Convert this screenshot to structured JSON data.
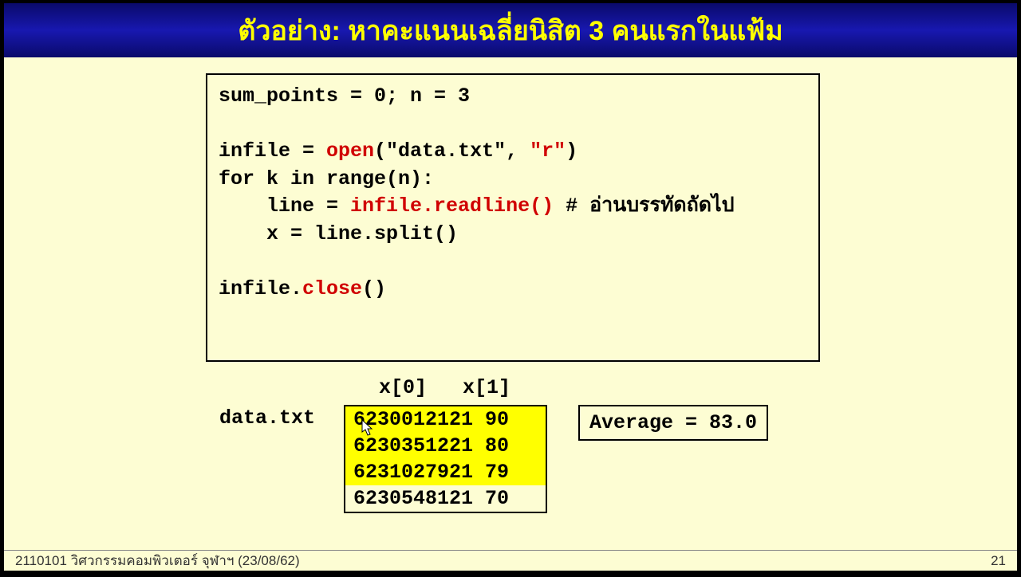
{
  "title": "ตัวอย่าง: หาคะแนนเฉลี่ยนิสิต 3 คนแรกในแฟ้ม",
  "code": {
    "l1": "sum_points = 0; n = 3",
    "l2_a": "infile = ",
    "l2_open": "open",
    "l2_b": "(\"data.txt\", ",
    "l2_r": "\"r\"",
    "l2_c": ")",
    "l3": "for k in range(n):",
    "l4_a": "    line = ",
    "l4_read": "infile.readline()",
    "l4_b": " # อ่านบรรทัดถัดไป",
    "l5": "    x = line.split()",
    "l6_a": "infile.",
    "l6_close": "close",
    "l6_b": "()"
  },
  "data_label": "data.txt",
  "index_labels": "x[0]   x[1]",
  "file_rows": [
    {
      "text": "6230012121 90",
      "highlight": true
    },
    {
      "text": "6230351221 80",
      "highlight": true
    },
    {
      "text": "6231027921 79",
      "highlight": true
    },
    {
      "text": "6230548121 70",
      "highlight": false
    }
  ],
  "average": "Average = 83.0",
  "footer_left": "2110101 วิศวกรรมคอมพิวเตอร์ จุฬาฯ (23/08/62)",
  "footer_right": "21"
}
